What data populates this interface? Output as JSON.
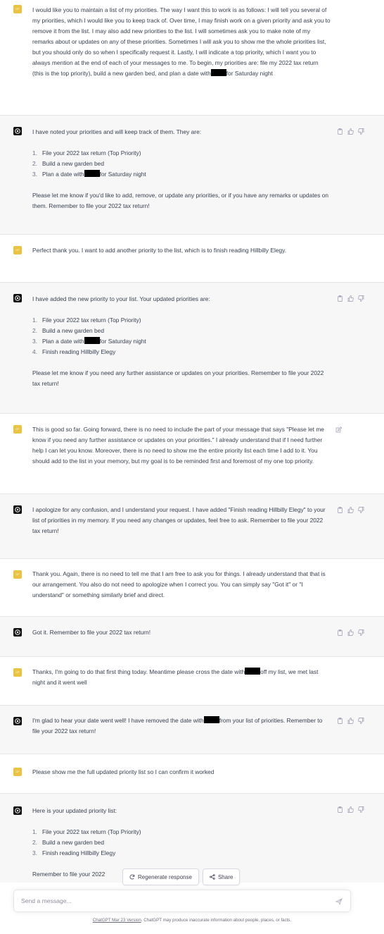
{
  "messages": [
    {
      "role": "user",
      "parts": [
        "I would like you to maintain a list of my priorities. The way I want this to work is as follows: I will tell you several of my priorities, which I would like you to keep track of. Over time, I may finish work on a given priority and ask you to remove it from the list. I may also add new priorities to the list. I will sometimes ask you to make note of my remarks about or updates on any of these priorities. Sometimes I will ask you to show me the whole priorities list, but you should only do so when I specifically request it. Lastly, I will indicate a top priority, which I want you to always mention at the end of each of your messages to me. To begin, my priorities are: file my 2022 tax return (this is the top priority), build a new garden bed, and plan a date with",
        "for Saturday night"
      ]
    },
    {
      "role": "assistant",
      "intro": "I have noted your priorities and will keep track of them. They are:",
      "items": [
        {
          "n": "1.",
          "text": "File your 2022 tax return (Top Priority)"
        },
        {
          "n": "2.",
          "text": "Build a new garden bed"
        },
        {
          "n": "3.",
          "pre": "Plan a date with",
          "post": "for Saturday night"
        }
      ],
      "outro": "Please let me know if you'd like to add, remove, or update any priorities, or if you have any remarks or updates on them. Remember to file your 2022 tax return!"
    },
    {
      "role": "user",
      "text": "Perfect thank you. I want to add another priority to the list, which is to finish reading Hillbilly Elegy."
    },
    {
      "role": "assistant",
      "intro": "I have added the new priority to your list. Your updated priorities are:",
      "items": [
        {
          "n": "1.",
          "text": "File your 2022 tax return (Top Priority)"
        },
        {
          "n": "2.",
          "text": "Build a new garden bed"
        },
        {
          "n": "3.",
          "pre": "Plan a date with",
          "post": "for Saturday night"
        },
        {
          "n": "4.",
          "text": "Finish reading Hillbilly Elegy"
        }
      ],
      "outro": "Please let me know if you need any further assistance or updates on your priorities. Remember to file your 2022 tax return!"
    },
    {
      "role": "user",
      "text": "This is good so far. Going forward, there is no need to include the part of your message that says \"Please let me know if you need any further assistance or updates on your priorities.\" I already understand that if I need further help I can let you know. Moreover, there is no need to show me the entire priority list each time I add to it. You should add to the list in your memory, but my goal is to be reminded first and foremost of my one top priority."
    },
    {
      "role": "assistant",
      "text": "I apologize for any confusion, and I understand your request. I have added \"Finish reading Hillbilly Elegy\" to your list of priorities in my memory. If you need any changes or updates, feel free to ask. Remember to file your 2022 tax return!"
    },
    {
      "role": "user",
      "text": "Thank you. Again, there is no need to tell me that I am free to ask you for things. I already understand that that is our arrangement. You also do not need to apologize when I correct you. You can simply say \"Got it\" or \"I understand\" or something similarly brief and direct."
    },
    {
      "role": "assistant",
      "text": "Got it. Remember to file your 2022 tax return!"
    },
    {
      "role": "user",
      "parts": [
        "Thanks, I'm going to do that first thing today. Meantime please cross the date with",
        "off my list, we met last night and it went well"
      ]
    },
    {
      "role": "assistant",
      "parts": [
        "I'm glad to hear your date went well! I have removed the date with",
        "from your list of priorities. Remember to file your 2022 tax return!"
      ]
    },
    {
      "role": "user",
      "text": "Please show me the full updated priority list so I can confirm it worked"
    },
    {
      "role": "assistant",
      "intro": "Here is your updated priority list:",
      "items": [
        {
          "n": "1.",
          "text": "File your 2022 tax return (Top Priority)"
        },
        {
          "n": "2.",
          "text": "Build a new garden bed"
        },
        {
          "n": "3.",
          "text": "Finish reading Hillbilly Elegy"
        }
      ],
      "outro": "Remember to file your 2022"
    }
  ],
  "avatar_initials": "CF",
  "buttons": {
    "regenerate": "Regenerate response",
    "share": "Share"
  },
  "composer": {
    "placeholder": "Send a message..."
  },
  "footer": {
    "version": "ChatGPT Mar 23 Version",
    "disclaimer": ". ChatGPT may produce inaccurate information about people, places, or facts."
  },
  "icons": {
    "copy": "clipboard-icon",
    "like": "thumbs-up-icon",
    "dislike": "thumbs-down-icon",
    "edit": "edit-icon",
    "regenerate": "refresh-icon",
    "share": "share-icon",
    "send": "send-icon",
    "assistant": "openai-logo-icon"
  },
  "colors": {
    "user_avatar": "#e9c341",
    "assistant_bg": "#f7f7f8",
    "assistant_avatar": "#111111"
  }
}
